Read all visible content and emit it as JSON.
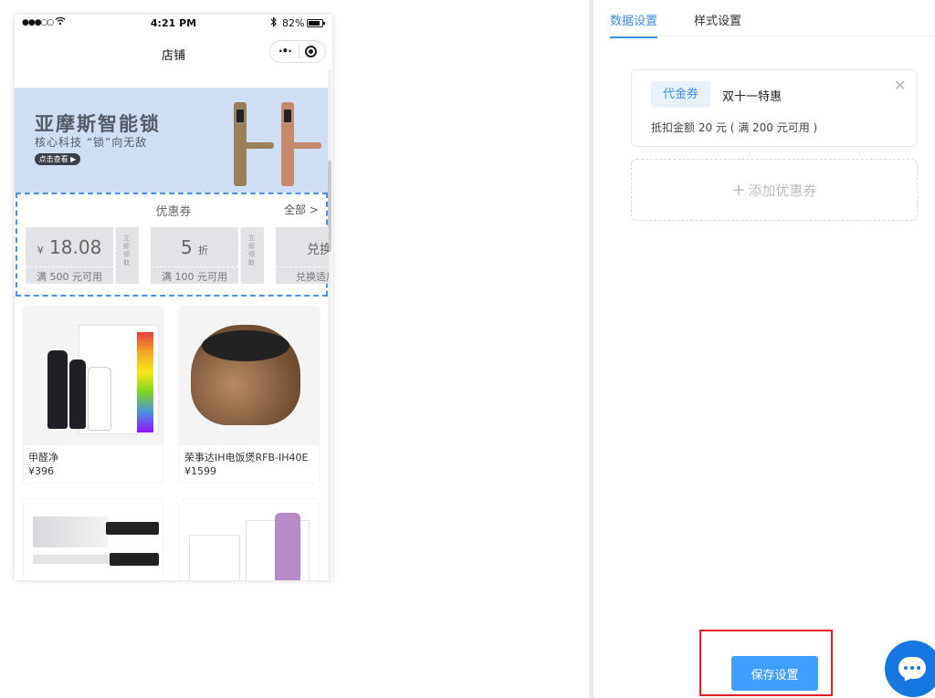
{
  "phone": {
    "status": {
      "time": "4:21 PM",
      "battery": "82%"
    },
    "nav_title": "店铺",
    "banner": {
      "title": "亚摩斯智能锁",
      "subtitle": "核心科技 “锁”向无敌",
      "button": "点击查看 ▶"
    },
    "coupon_section": {
      "title": "优惠券",
      "all_label": "全部 >",
      "claim_label": "立即领取",
      "coupons": [
        {
          "value": "18.08",
          "prefix": "¥",
          "suffix": "",
          "condition": "满 500 元可用"
        },
        {
          "value": "5",
          "prefix": "",
          "suffix": "折",
          "condition": "满 100 元可用"
        },
        {
          "value": "兑换券",
          "prefix": "",
          "suffix": "",
          "condition": "兑换适用商品"
        }
      ]
    },
    "products": [
      {
        "name": "甲醛净",
        "price": "¥396"
      },
      {
        "name": "荣事达IH电饭煲RFB-IH40E",
        "price": "¥1599"
      },
      {
        "name": "",
        "price": ""
      },
      {
        "name": "",
        "price": ""
      }
    ]
  },
  "panel": {
    "tabs": [
      {
        "label": "数据设置",
        "active": true
      },
      {
        "label": "样式设置",
        "active": false
      }
    ],
    "coupon_card": {
      "tag": "代金券",
      "name": "双十一特惠",
      "desc": "抵扣金额 20 元 ( 满 200 元可用 )"
    },
    "add_coupon": "添加优惠券",
    "save_button": "保存设置"
  },
  "colors": {
    "accent": "#409eff",
    "highlight": "#e51c23",
    "dashed_select": "#4b90e6"
  },
  "icons": [
    "wifi-icon",
    "bluetooth-icon",
    "battery-icon",
    "more-dots-icon",
    "target-icon",
    "close-icon",
    "plus-icon",
    "chat-icon"
  ]
}
